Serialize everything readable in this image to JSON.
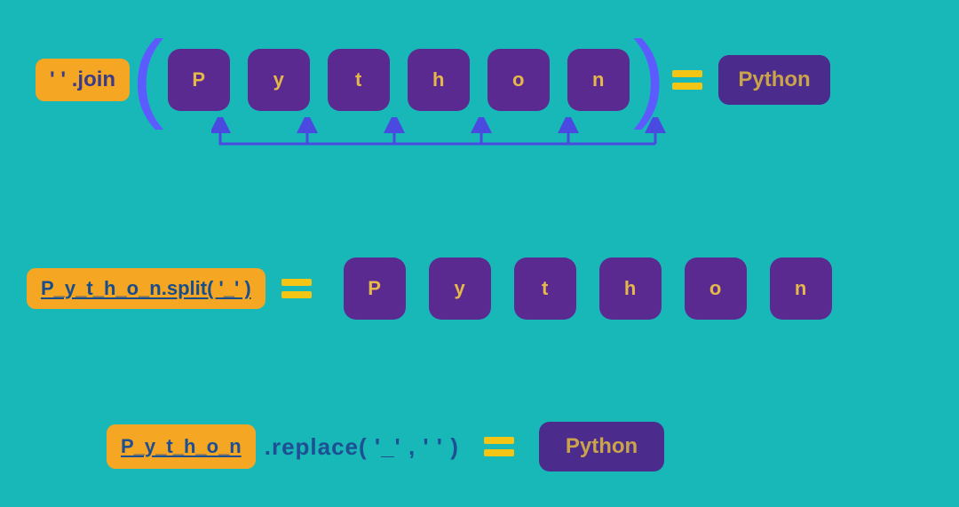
{
  "colors": {
    "bg": "#19B8B8",
    "yellow": "#F5A623",
    "purple": "#5B2A91",
    "purple_dark": "#4B2B8C",
    "letter": "#E5B84A",
    "text_blue": "#184E8B",
    "arrow": "#4A4AE0"
  },
  "row1": {
    "join_label": "' '  .join",
    "letters": [
      "P",
      "y",
      "t",
      "h",
      "o",
      "n"
    ],
    "result": "Python"
  },
  "row2": {
    "split_label": "P_y_t_h_o_n.split(  '_'  )",
    "letters": [
      "P",
      "y",
      "t",
      "h",
      "o",
      "n"
    ]
  },
  "row3": {
    "badge": "P_y_t_h_o_n",
    "replace_suffix": ".replace(   '_'  , '  '  )",
    "result": "Python"
  }
}
